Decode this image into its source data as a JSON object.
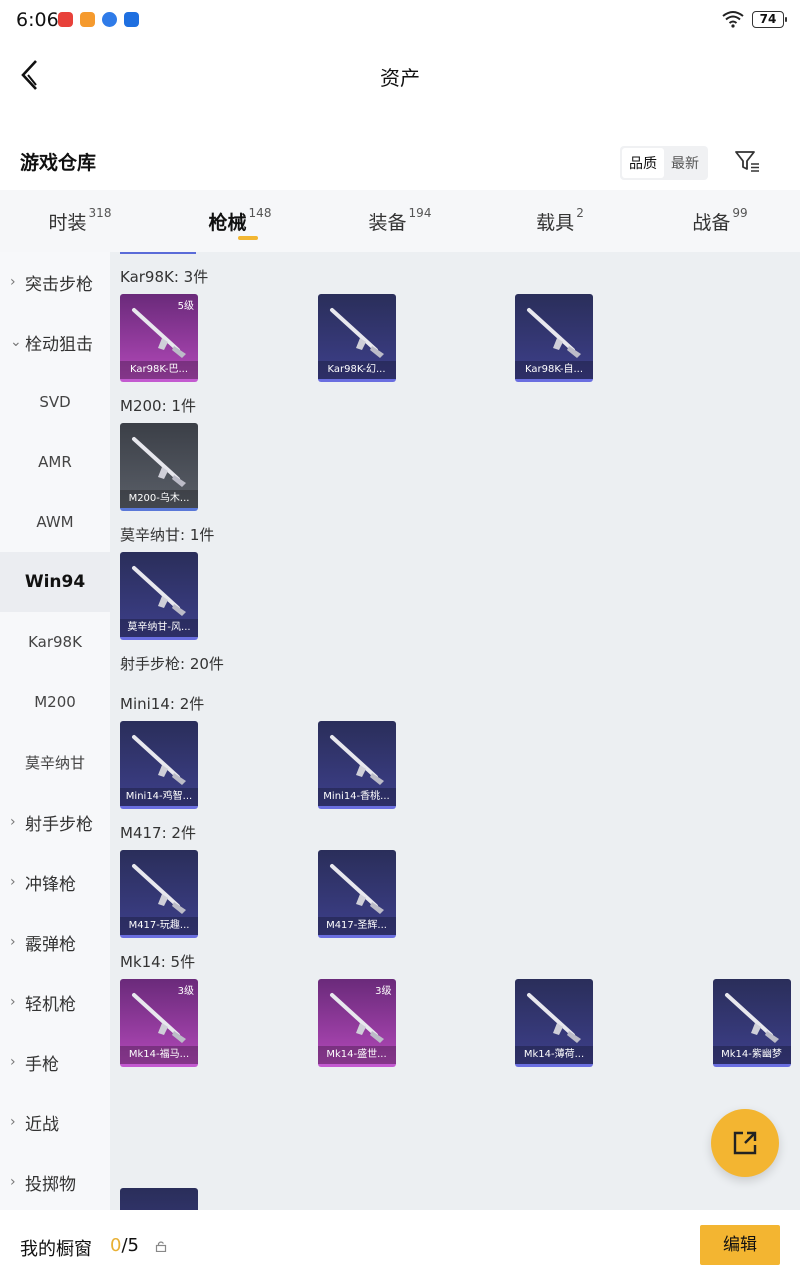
{
  "status": {
    "time": "6:06",
    "battery": "74"
  },
  "header": {
    "title": "资产"
  },
  "section": {
    "title": "游戏仓库",
    "sort_options": [
      "品质",
      "最新"
    ]
  },
  "tabs": [
    {
      "label": "时装",
      "count": "318"
    },
    {
      "label": "枪械",
      "count": "148"
    },
    {
      "label": "装备",
      "count": "194"
    },
    {
      "label": "载具",
      "count": "2"
    },
    {
      "label": "战备",
      "count": "99"
    }
  ],
  "sidebar": {
    "items": [
      {
        "label": "突击步枪"
      },
      {
        "label": "栓动狙击"
      },
      {
        "label": "SVD"
      },
      {
        "label": "AMR"
      },
      {
        "label": "AWM"
      },
      {
        "label": "Win94"
      },
      {
        "label": "Kar98K"
      },
      {
        "label": "M200"
      },
      {
        "label": "莫辛纳甘"
      },
      {
        "label": "射手步枪"
      },
      {
        "label": "冲锋枪"
      },
      {
        "label": "霰弹枪"
      },
      {
        "label": "轻机枪"
      },
      {
        "label": "手枪"
      },
      {
        "label": "近战"
      },
      {
        "label": "投掷物"
      }
    ]
  },
  "groups": [
    {
      "label": "Kar98K: 3件",
      "items": [
        {
          "name": "Kar98K-巴...",
          "level": "5级",
          "color": "#b148b8",
          "icon": "sniper-rifle-icon"
        },
        {
          "name": "Kar98K-幻...",
          "level": "",
          "color": "#3d3f8a",
          "icon": "sniper-rifle-icon"
        },
        {
          "name": "Kar98K-自...",
          "level": "",
          "color": "#3d3f8a",
          "icon": "sniper-rifle-icon"
        }
      ]
    },
    {
      "label": "M200: 1件",
      "items": [
        {
          "name": "M200-乌木...",
          "level": "",
          "color": "#5a5f68",
          "icon": "sniper-rifle-icon"
        }
      ]
    },
    {
      "label": "莫辛纳甘: 1件",
      "items": [
        {
          "name": "莫辛纳甘-风...",
          "level": "",
          "color": "#3d3f8a",
          "icon": "sniper-rifle-icon"
        }
      ]
    },
    {
      "label": "射手步枪: 20件",
      "items": []
    },
    {
      "label": "Mini14: 2件",
      "items": [
        {
          "name": "Mini14-鸡智...",
          "level": "",
          "color": "#3d3f8a",
          "icon": "marksman-rifle-icon"
        },
        {
          "name": "Mini14-香桃...",
          "level": "",
          "color": "#3d3f8a",
          "icon": "marksman-rifle-icon"
        }
      ]
    },
    {
      "label": "M417: 2件",
      "items": [
        {
          "name": "M417-玩趣...",
          "level": "",
          "color": "#3d3f8a",
          "icon": "marksman-rifle-icon"
        },
        {
          "name": "M417-圣辉...",
          "level": "",
          "color": "#3d3f8a",
          "icon": "marksman-rifle-icon"
        }
      ]
    },
    {
      "label": "Mk14: 5件",
      "items": [
        {
          "name": "Mk14-福马...",
          "level": "3级",
          "color": "#b148b8",
          "icon": "marksman-rifle-icon"
        },
        {
          "name": "Mk14-盛世...",
          "level": "3级",
          "color": "#b148b8",
          "icon": "marksman-rifle-icon"
        },
        {
          "name": "Mk14-薄荷...",
          "level": "",
          "color": "#3d3f8a",
          "icon": "marksman-rifle-icon"
        },
        {
          "name": "Mk14-紫幽梦",
          "level": "",
          "color": "#3d3f8a",
          "icon": "marksman-rifle-icon"
        }
      ]
    }
  ],
  "showcase": {
    "label": "我的橱窗",
    "current": "0",
    "total": "/5",
    "edit_label": "编辑"
  },
  "colors": {
    "accent": "#f3b531",
    "panel": "#eceff2",
    "tab_indicator": "#f2b632"
  }
}
